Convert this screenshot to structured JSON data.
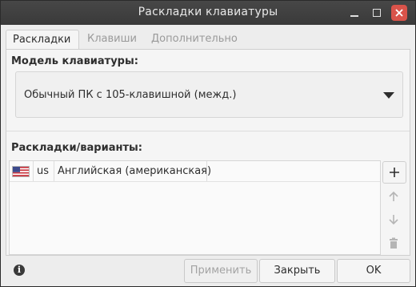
{
  "window": {
    "title": "Раскладки клавиатуры"
  },
  "tabs": [
    {
      "label": "Раскладки",
      "active": true
    },
    {
      "label": "Клавиши",
      "active": false
    },
    {
      "label": "Дополнительно",
      "active": false
    }
  ],
  "model": {
    "label": "Модель клавиатуры:",
    "selected": "Обычный ПК с 105-клавишной (межд.)"
  },
  "layouts": {
    "label": "Раскладки/варианты:",
    "rows": [
      {
        "flag": "us-flag-icon",
        "code": "us",
        "name": "Английская (американская)"
      }
    ]
  },
  "side_buttons": [
    "plus-icon",
    "arrow-up-icon",
    "arrow-down-icon",
    "trash-icon"
  ],
  "footer": {
    "apply_label": "Применить",
    "close_label": "Закрыть",
    "ok_label": "OK"
  },
  "colors": {
    "titlebar": "#3f3f3f",
    "close_button": "#d9534a",
    "panel": "#f5f5f5"
  }
}
